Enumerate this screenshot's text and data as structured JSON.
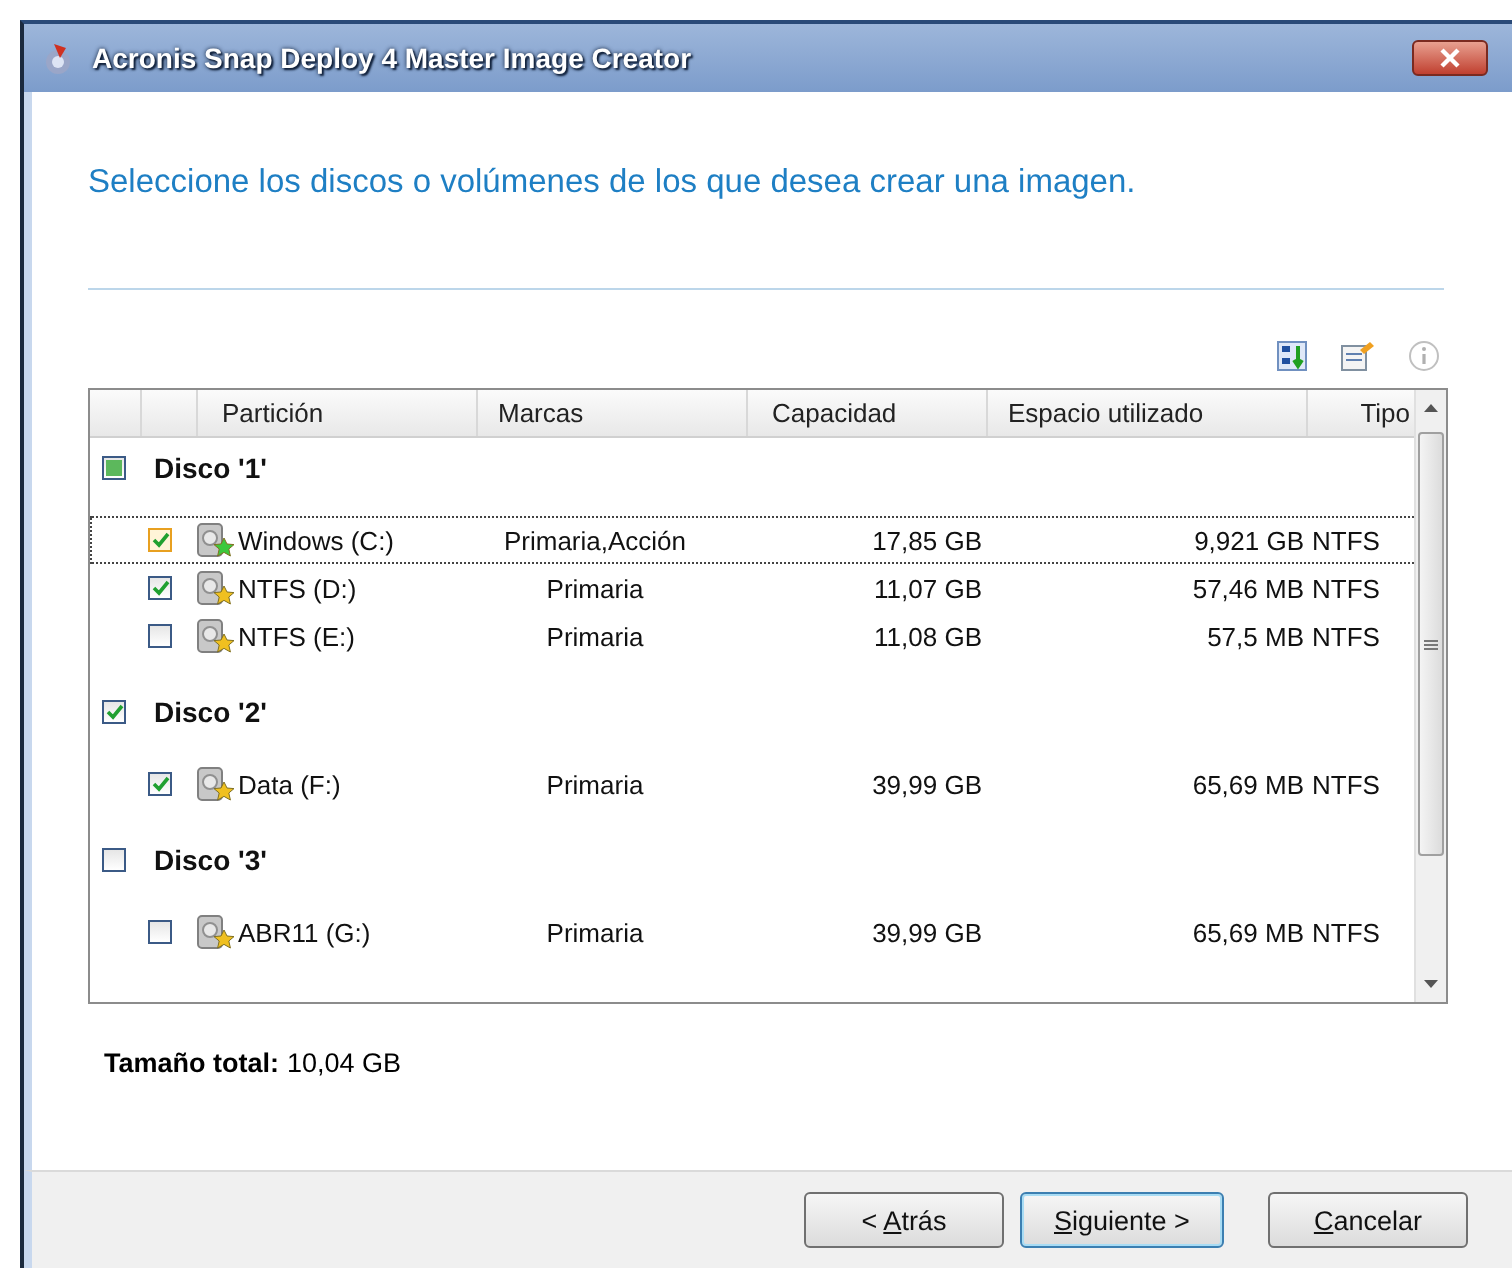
{
  "window": {
    "title": "Acronis Snap Deploy 4 Master Image Creator"
  },
  "heading": "Seleccione los discos o volúmenes de los que desea crear una imagen.",
  "table": {
    "columns": [
      "Partición",
      "Marcas",
      "Capacidad",
      "Espacio utilizado",
      "Tipo"
    ],
    "disks": [
      {
        "label": "Disco '1'",
        "checked": true,
        "partial": true,
        "partitions": [
          {
            "name": "Windows (C:)",
            "flags": "Primaria,Acción",
            "capacity": "17,85 GB",
            "used": "9,921 GB",
            "type": "NTFS",
            "checked": true,
            "focused": true,
            "color": "#3cc83c"
          },
          {
            "name": "NTFS (D:)",
            "flags": "Primaria",
            "capacity": "11,07 GB",
            "used": "57,46 MB",
            "type": "NTFS",
            "checked": true,
            "focused": false,
            "color": "#f0c020"
          },
          {
            "name": "NTFS (E:)",
            "flags": "Primaria",
            "capacity": "11,08 GB",
            "used": "57,5 MB",
            "type": "NTFS",
            "checked": false,
            "focused": false,
            "color": "#f0c020"
          }
        ]
      },
      {
        "label": "Disco '2'",
        "checked": true,
        "partial": false,
        "partitions": [
          {
            "name": "Data (F:)",
            "flags": "Primaria",
            "capacity": "39,99 GB",
            "used": "65,69 MB",
            "type": "NTFS",
            "checked": true,
            "focused": false,
            "color": "#f0c020"
          }
        ]
      },
      {
        "label": "Disco '3'",
        "checked": false,
        "partial": false,
        "partitions": [
          {
            "name": "ABR11 (G:)",
            "flags": "Primaria",
            "capacity": "39,99 GB",
            "used": "65,69 MB",
            "type": "NTFS",
            "checked": false,
            "focused": false,
            "color": "#f0c020"
          }
        ]
      }
    ]
  },
  "total": {
    "label": "Tamaño total:",
    "value": "10,04 GB"
  },
  "buttons": [
    {
      "before": "< ",
      "key": "A",
      "after": "trás",
      "default": false
    },
    {
      "key": "S",
      "after": "iguiente >",
      "default": true
    },
    {
      "key": "C",
      "after": "ancelar",
      "default": false
    }
  ]
}
